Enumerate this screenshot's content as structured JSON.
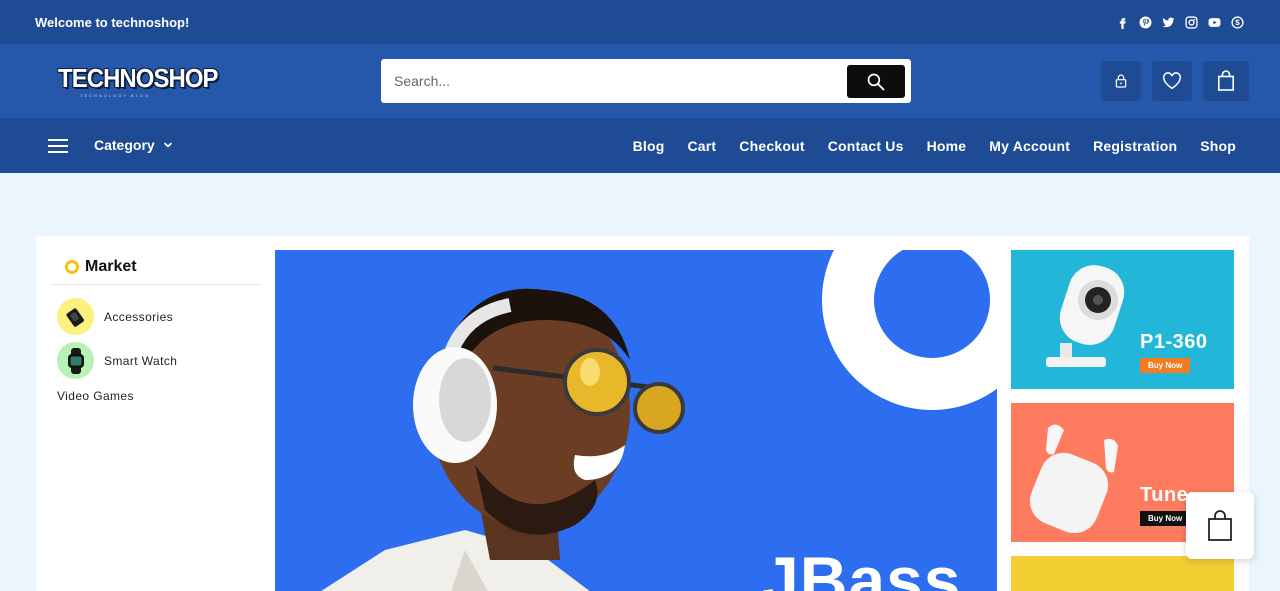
{
  "topbar": {
    "welcome": "Welcome to technoshop!",
    "social": [
      "facebook-icon",
      "pinterest-icon",
      "twitter-icon",
      "instagram-icon",
      "youtube-icon",
      "skype-icon"
    ]
  },
  "header": {
    "logo_text": "TECHNOSHOP",
    "logo_tagline": "TECHNOLOGY BLOG",
    "search_placeholder": "Search...",
    "icons": [
      "lock-icon",
      "heart-icon",
      "bag-icon"
    ]
  },
  "nav": {
    "category_label": "Category",
    "menu": [
      "Blog",
      "Cart",
      "Checkout",
      "Contact Us",
      "Home",
      "My Account",
      "Registration",
      "Shop"
    ]
  },
  "sidebar": {
    "title": "Market",
    "items": [
      {
        "label": "Accessories",
        "icon": "accessories-icon"
      },
      {
        "label": "Smart Watch",
        "icon": "smart-watch-icon"
      },
      {
        "label": "Video Games"
      }
    ]
  },
  "hero": {
    "heading": "JBass"
  },
  "banners": [
    {
      "title": "P1-360",
      "button": "Buy Now"
    },
    {
      "title": "Tune",
      "button": "Buy Now"
    }
  ],
  "colors": {
    "topbar": "#1f4b94",
    "header": "#2558ab",
    "hero": "#2d6df0",
    "banner1": "#22b6d8",
    "banner2": "#ff7b5f",
    "banner3": "#f4cf33",
    "accent_orange": "#f47c20"
  }
}
